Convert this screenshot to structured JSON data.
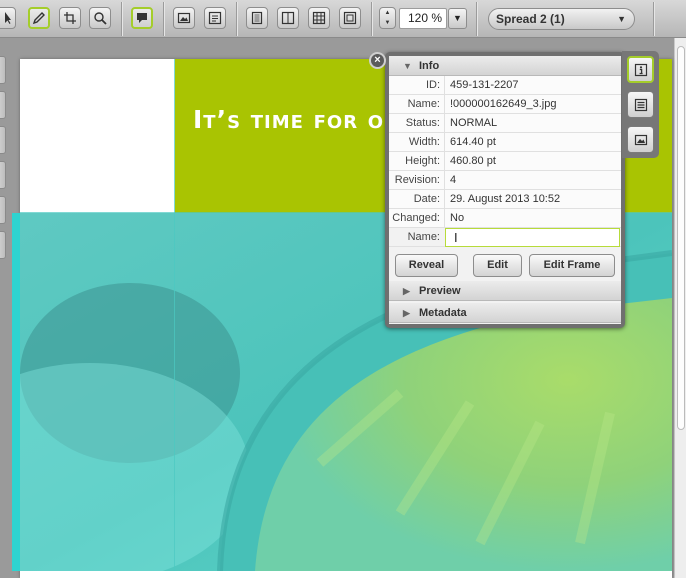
{
  "toolbar": {
    "tools": [
      {
        "name": "select-tool",
        "icon": "arrow-select-icon"
      },
      {
        "name": "pen-tool",
        "icon": "pen-icon",
        "active": true
      },
      {
        "name": "crop-tool",
        "icon": "crop-icon"
      },
      {
        "name": "zoom-tool",
        "icon": "magnifier-icon"
      },
      {
        "name": "comment-tool",
        "icon": "comment-icon",
        "active": true
      },
      {
        "name": "image-view",
        "icon": "image-icon"
      },
      {
        "name": "text-view",
        "icon": "text-frame-icon"
      },
      {
        "name": "page-view-1",
        "icon": "page-icon"
      },
      {
        "name": "page-view-2",
        "icon": "two-page-icon"
      },
      {
        "name": "grid-view",
        "icon": "grid-icon"
      },
      {
        "name": "spread-view",
        "icon": "spread-icon"
      }
    ],
    "zoom_value": "120 %",
    "spread_label": "Spread 2 (1)"
  },
  "document": {
    "headline": "It’s time for orange fizz",
    "banner_color": "#a9c402",
    "photo_tint": "#4fd0c9"
  },
  "info_panel": {
    "title": "Info",
    "rows": [
      {
        "label": "ID:",
        "value": "459-131-2207"
      },
      {
        "label": "Name:",
        "value": "!000000162649_3.jpg"
      },
      {
        "label": "Status:",
        "value": "NORMAL"
      },
      {
        "label": "Width:",
        "value": "614.40 pt"
      },
      {
        "label": "Height:",
        "value": "460.80 pt"
      },
      {
        "label": "Revision:",
        "value": "4"
      },
      {
        "label": "Date:",
        "value": "29. August 2013 10:52"
      },
      {
        "label": "Changed:",
        "value": "No"
      }
    ],
    "name_field_label": "Name:",
    "name_field_value": "",
    "buttons": {
      "reveal": "Reveal",
      "edit": "Edit",
      "edit_frame": "Edit Frame"
    },
    "preview_label": "Preview",
    "metadata_label": "Metadata",
    "accent": "#a4cd2a"
  },
  "side_panel": [
    {
      "name": "info-tab",
      "icon": "info-icon",
      "active": true
    },
    {
      "name": "list-tab",
      "icon": "list-icon"
    },
    {
      "name": "image-tab",
      "icon": "image-icon"
    }
  ]
}
